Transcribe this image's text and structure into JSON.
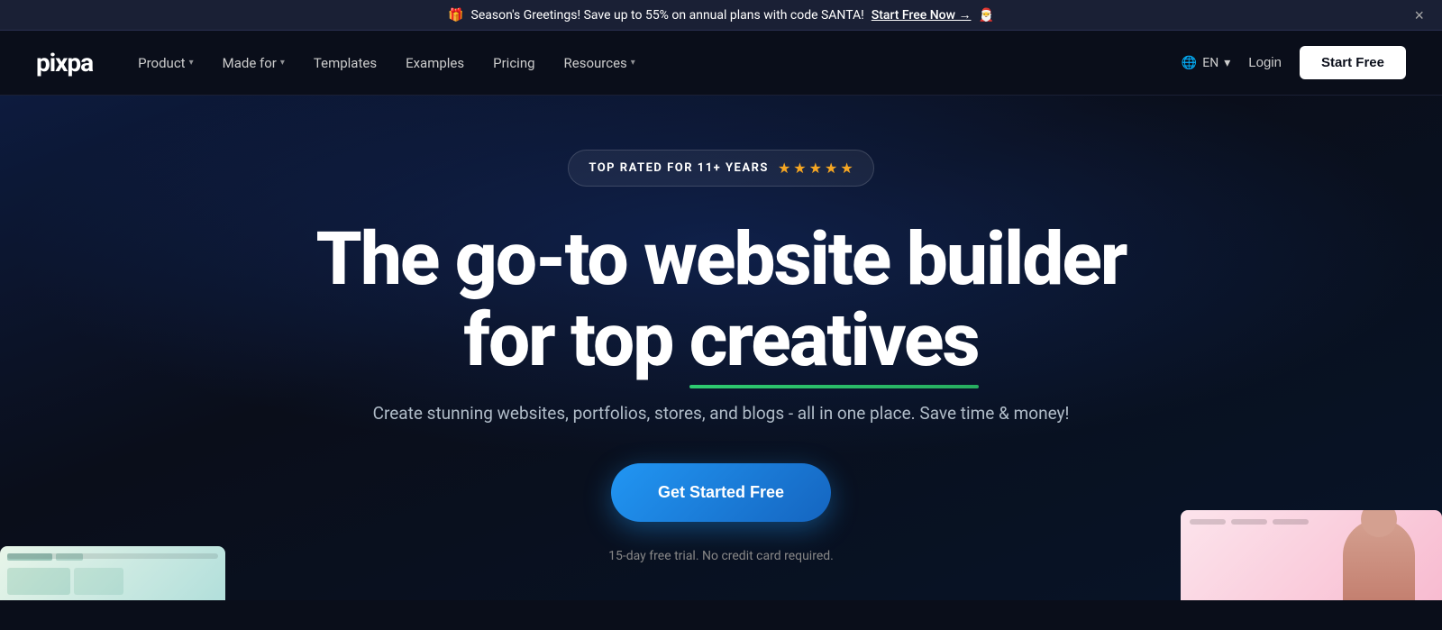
{
  "announcement": {
    "gift_emoji": "🎁",
    "text": "Season's Greetings! Save up to 55% on annual plans with code SANTA!",
    "cta_text": "Start Free Now →",
    "santa_emoji": "🎅",
    "close_label": "×"
  },
  "navbar": {
    "logo": "pixpa",
    "nav_items": [
      {
        "label": "Product",
        "has_dropdown": true
      },
      {
        "label": "Made for",
        "has_dropdown": true
      },
      {
        "label": "Templates",
        "has_dropdown": false
      },
      {
        "label": "Examples",
        "has_dropdown": false
      },
      {
        "label": "Pricing",
        "has_dropdown": false
      },
      {
        "label": "Resources",
        "has_dropdown": true
      }
    ],
    "lang": "EN",
    "login_label": "Login",
    "start_free_label": "Start Free"
  },
  "hero": {
    "badge_text": "TOP RATED FOR 11+ YEARS",
    "stars": [
      "★",
      "★",
      "★",
      "★",
      "★"
    ],
    "title_line1": "The go-to website builder",
    "title_line2_prefix": "for top ",
    "title_line2_keyword": "creatives",
    "subtitle": "Create stunning websites, portfolios, stores, and blogs - all in one place. Save time & money!",
    "cta_button": "Get Started Free",
    "trial_text": "15-day free trial. No credit card required."
  },
  "colors": {
    "background": "#0a0e1a",
    "hero_bg": "#0d1b3e",
    "accent_blue": "#2196f3",
    "accent_green": "#2ecc71",
    "star_color": "#f5a623",
    "start_free_bg": "#ffffff",
    "announcement_bg": "#1a2035"
  }
}
